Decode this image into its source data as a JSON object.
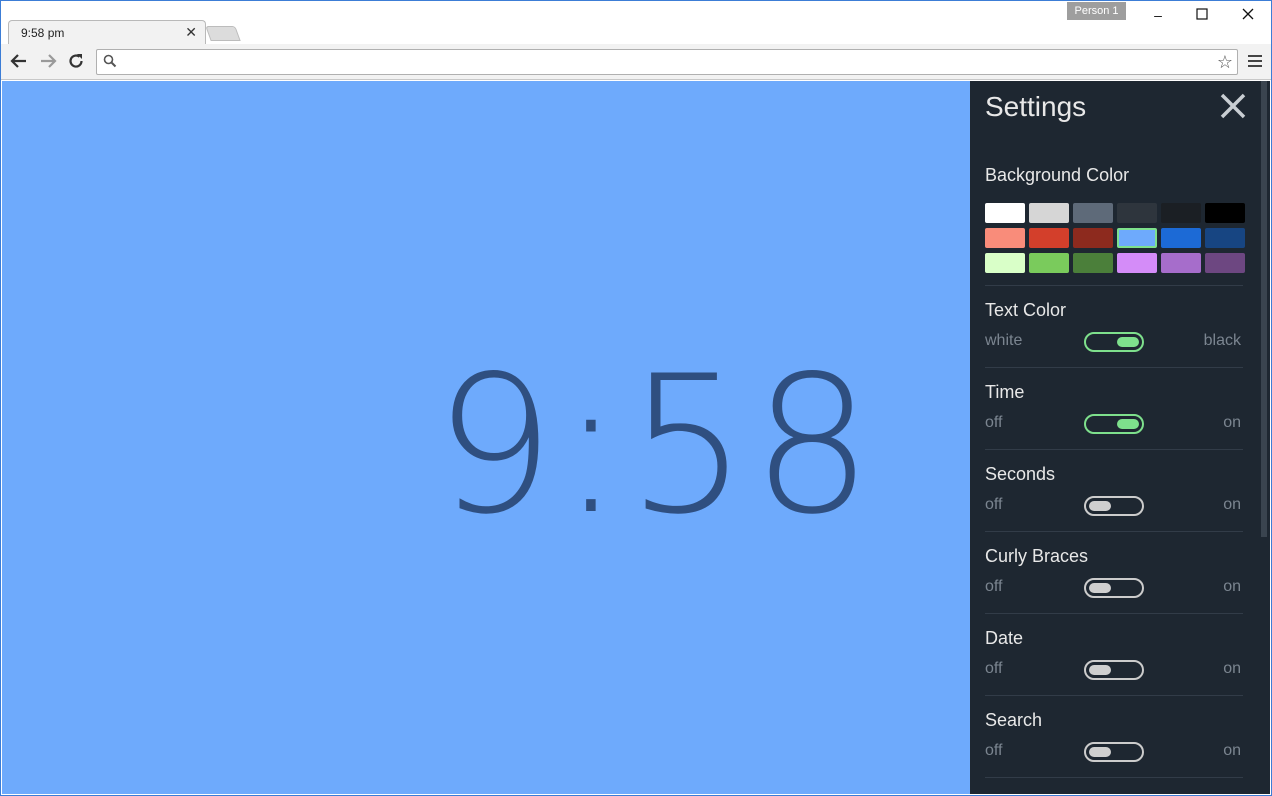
{
  "browser": {
    "tab_title": "9:58 pm",
    "tab_close_icon": "close-icon",
    "profile_name": "Person 1",
    "address_value": "",
    "window_controls": {
      "minimize": "–",
      "maximize": "☐",
      "close": "✕"
    },
    "nav": {
      "back": "←",
      "forward": "→",
      "reload": "↻"
    }
  },
  "clock": {
    "time": "9:58",
    "color": "#2f4f80"
  },
  "page_background": "#6eaafc",
  "settings": {
    "title": "Settings",
    "background_color": {
      "label": "Background Color",
      "swatches": [
        "#ffffff",
        "#d6d6d6",
        "#5e6a79",
        "#2e353d",
        "#1b1f24",
        "#000000",
        "#f98c7a",
        "#d33f2b",
        "#8d2a1e",
        "#6eaafc",
        "#1c6ad6",
        "#174582",
        "#d9ffc8",
        "#7acb5c",
        "#4b7f3a",
        "#d48cf8",
        "#a66dcb",
        "#6d4781"
      ],
      "selected_index": 9
    },
    "text_color": {
      "label": "Text Color",
      "left": "white",
      "right": "black",
      "on": true
    },
    "time": {
      "label": "Time",
      "left": "off",
      "right": "on",
      "on": true
    },
    "seconds": {
      "label": "Seconds",
      "left": "off",
      "right": "on",
      "on": false
    },
    "curly_braces": {
      "label": "Curly Braces",
      "left": "off",
      "right": "on",
      "on": false
    },
    "date": {
      "label": "Date",
      "left": "off",
      "right": "on",
      "on": false
    },
    "search": {
      "label": "Search",
      "left": "off",
      "right": "on",
      "on": false
    }
  }
}
